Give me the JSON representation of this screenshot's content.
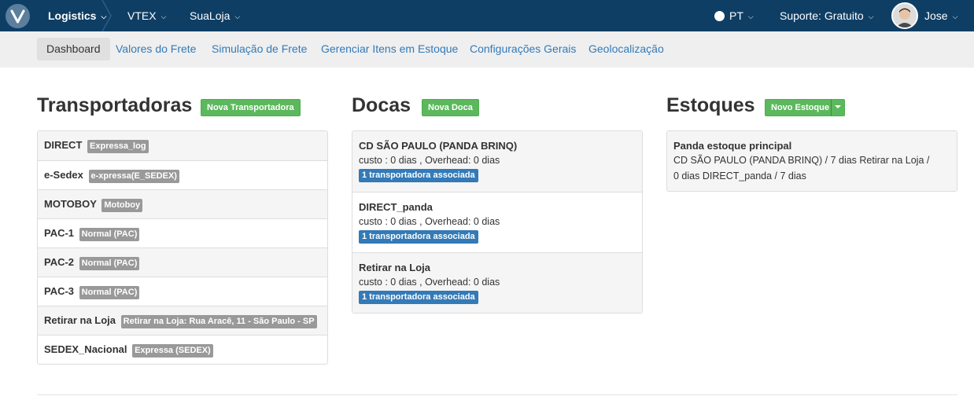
{
  "topbar": {
    "app_name": "Logistics",
    "menu_vtex": "VTEX",
    "menu_store": "SuaLoja",
    "language": "PT",
    "support": "Suporte: Gratuito",
    "user_name": "Jose",
    "background_color": "#0f3e64"
  },
  "subnav": {
    "tabs": [
      {
        "label": "Dashboard"
      },
      {
        "label": "Valores do Frete"
      },
      {
        "label": "Simulação de Frete"
      },
      {
        "label": "Gerenciar Itens em Estoque"
      },
      {
        "label": "Configurações Gerais"
      },
      {
        "label": "Geolocalização"
      }
    ]
  },
  "carriers": {
    "title": "Transportadoras",
    "new_button": "Nova Transportadora",
    "items": [
      {
        "name": "DIRECT",
        "tag": "Expressa_log"
      },
      {
        "name": "e-Sedex",
        "tag": "e-xpressa(E_SEDEX)"
      },
      {
        "name": "MOTOBOY",
        "tag": "Motoboy"
      },
      {
        "name": "PAC-1",
        "tag": "Normal (PAC)"
      },
      {
        "name": "PAC-2",
        "tag": "Normal (PAC)"
      },
      {
        "name": "PAC-3",
        "tag": "Normal (PAC)"
      },
      {
        "name": "Retirar na Loja",
        "tag": "Retirar na Loja: Rua Aracê, 11 - São Paulo - SP"
      },
      {
        "name": "SEDEX_Nacional",
        "tag": "Expressa (SEDEX)"
      }
    ]
  },
  "docks": {
    "title": "Docas",
    "new_button": "Nova Doca",
    "items": [
      {
        "name": "CD SÃO PAULO (PANDA BRINQ)",
        "meta": "custo : 0 dias , Overhead: 0 dias",
        "badge": "1 transportadora associada"
      },
      {
        "name": "DIRECT_panda",
        "meta": "custo : 0 dias , Overhead: 0 dias",
        "badge": "1 transportadora associada"
      },
      {
        "name": "Retirar na Loja",
        "meta": "custo : 0 dias , Overhead: 0 dias",
        "badge": "1 transportadora associada"
      }
    ]
  },
  "stocks": {
    "title": "Estoques",
    "new_button": "Novo Estoque",
    "items": [
      {
        "name": "Panda estoque principal",
        "line1": "CD SÃO PAULO (PANDA BRINQ) / 7 dias Retirar na Loja /",
        "line2": "0 dias DIRECT_panda / 7 dias"
      }
    ]
  },
  "colors": {
    "link": "#337ab7",
    "success": "#5cb85c",
    "label_default": "#999999",
    "label_primary": "#337ab7"
  }
}
